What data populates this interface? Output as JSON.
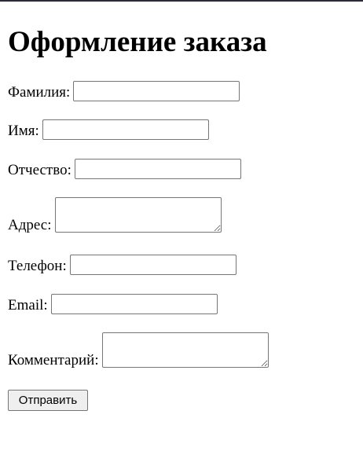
{
  "page": {
    "title": "Оформление заказа"
  },
  "form": {
    "fields": [
      {
        "label": "Фамилия:",
        "value": "",
        "type": "text"
      },
      {
        "label": "Имя:",
        "value": "",
        "type": "text"
      },
      {
        "label": "Отчество:",
        "value": "",
        "type": "text"
      },
      {
        "label": "Адрес:",
        "value": "",
        "type": "textarea"
      },
      {
        "label": "Телефон:",
        "value": "",
        "type": "text"
      },
      {
        "label": "Email:",
        "value": "",
        "type": "text"
      },
      {
        "label": "Комментарий:",
        "value": "",
        "type": "textarea"
      }
    ],
    "submit_label": "Отправить"
  },
  "colors": {
    "input_border": "#767676",
    "button_bg": "#efefef",
    "top_line": "#2b2b3a"
  }
}
